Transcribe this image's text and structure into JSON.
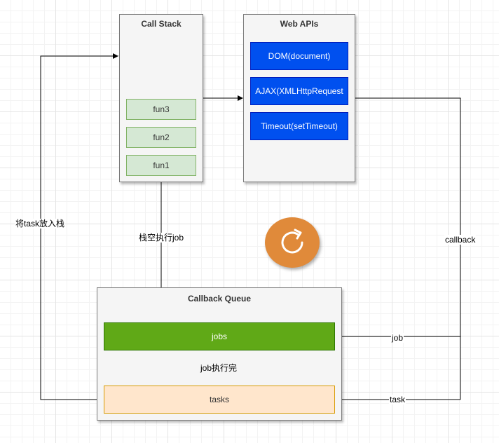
{
  "call_stack": {
    "title": "Call Stack",
    "frames": [
      "fun3",
      "fun2",
      "fun1"
    ]
  },
  "web_apis": {
    "title": "Web APIs",
    "items": [
      "DOM(document)",
      "AJAX(XMLHttpRequest",
      "Timeout(setTimeout)"
    ]
  },
  "callback_queue": {
    "title": "Callback Queue",
    "jobs": "jobs",
    "tasks": "tasks"
  },
  "edge_labels": {
    "push_task": "将task放入栈",
    "stack_empty_run_job": "栈空执行job",
    "callback": "callback",
    "job": "job",
    "task": "task",
    "job_done": "job执行完"
  },
  "event_loop_icon": "refresh-icon",
  "colors": {
    "container_fill": "#f5f5f5",
    "frame_fill": "#d5e8d4",
    "api_fill": "#0050ef",
    "jobs_fill": "#60a917",
    "tasks_fill": "#ffe6cc",
    "loop_icon_fill": "#e08a3a"
  }
}
